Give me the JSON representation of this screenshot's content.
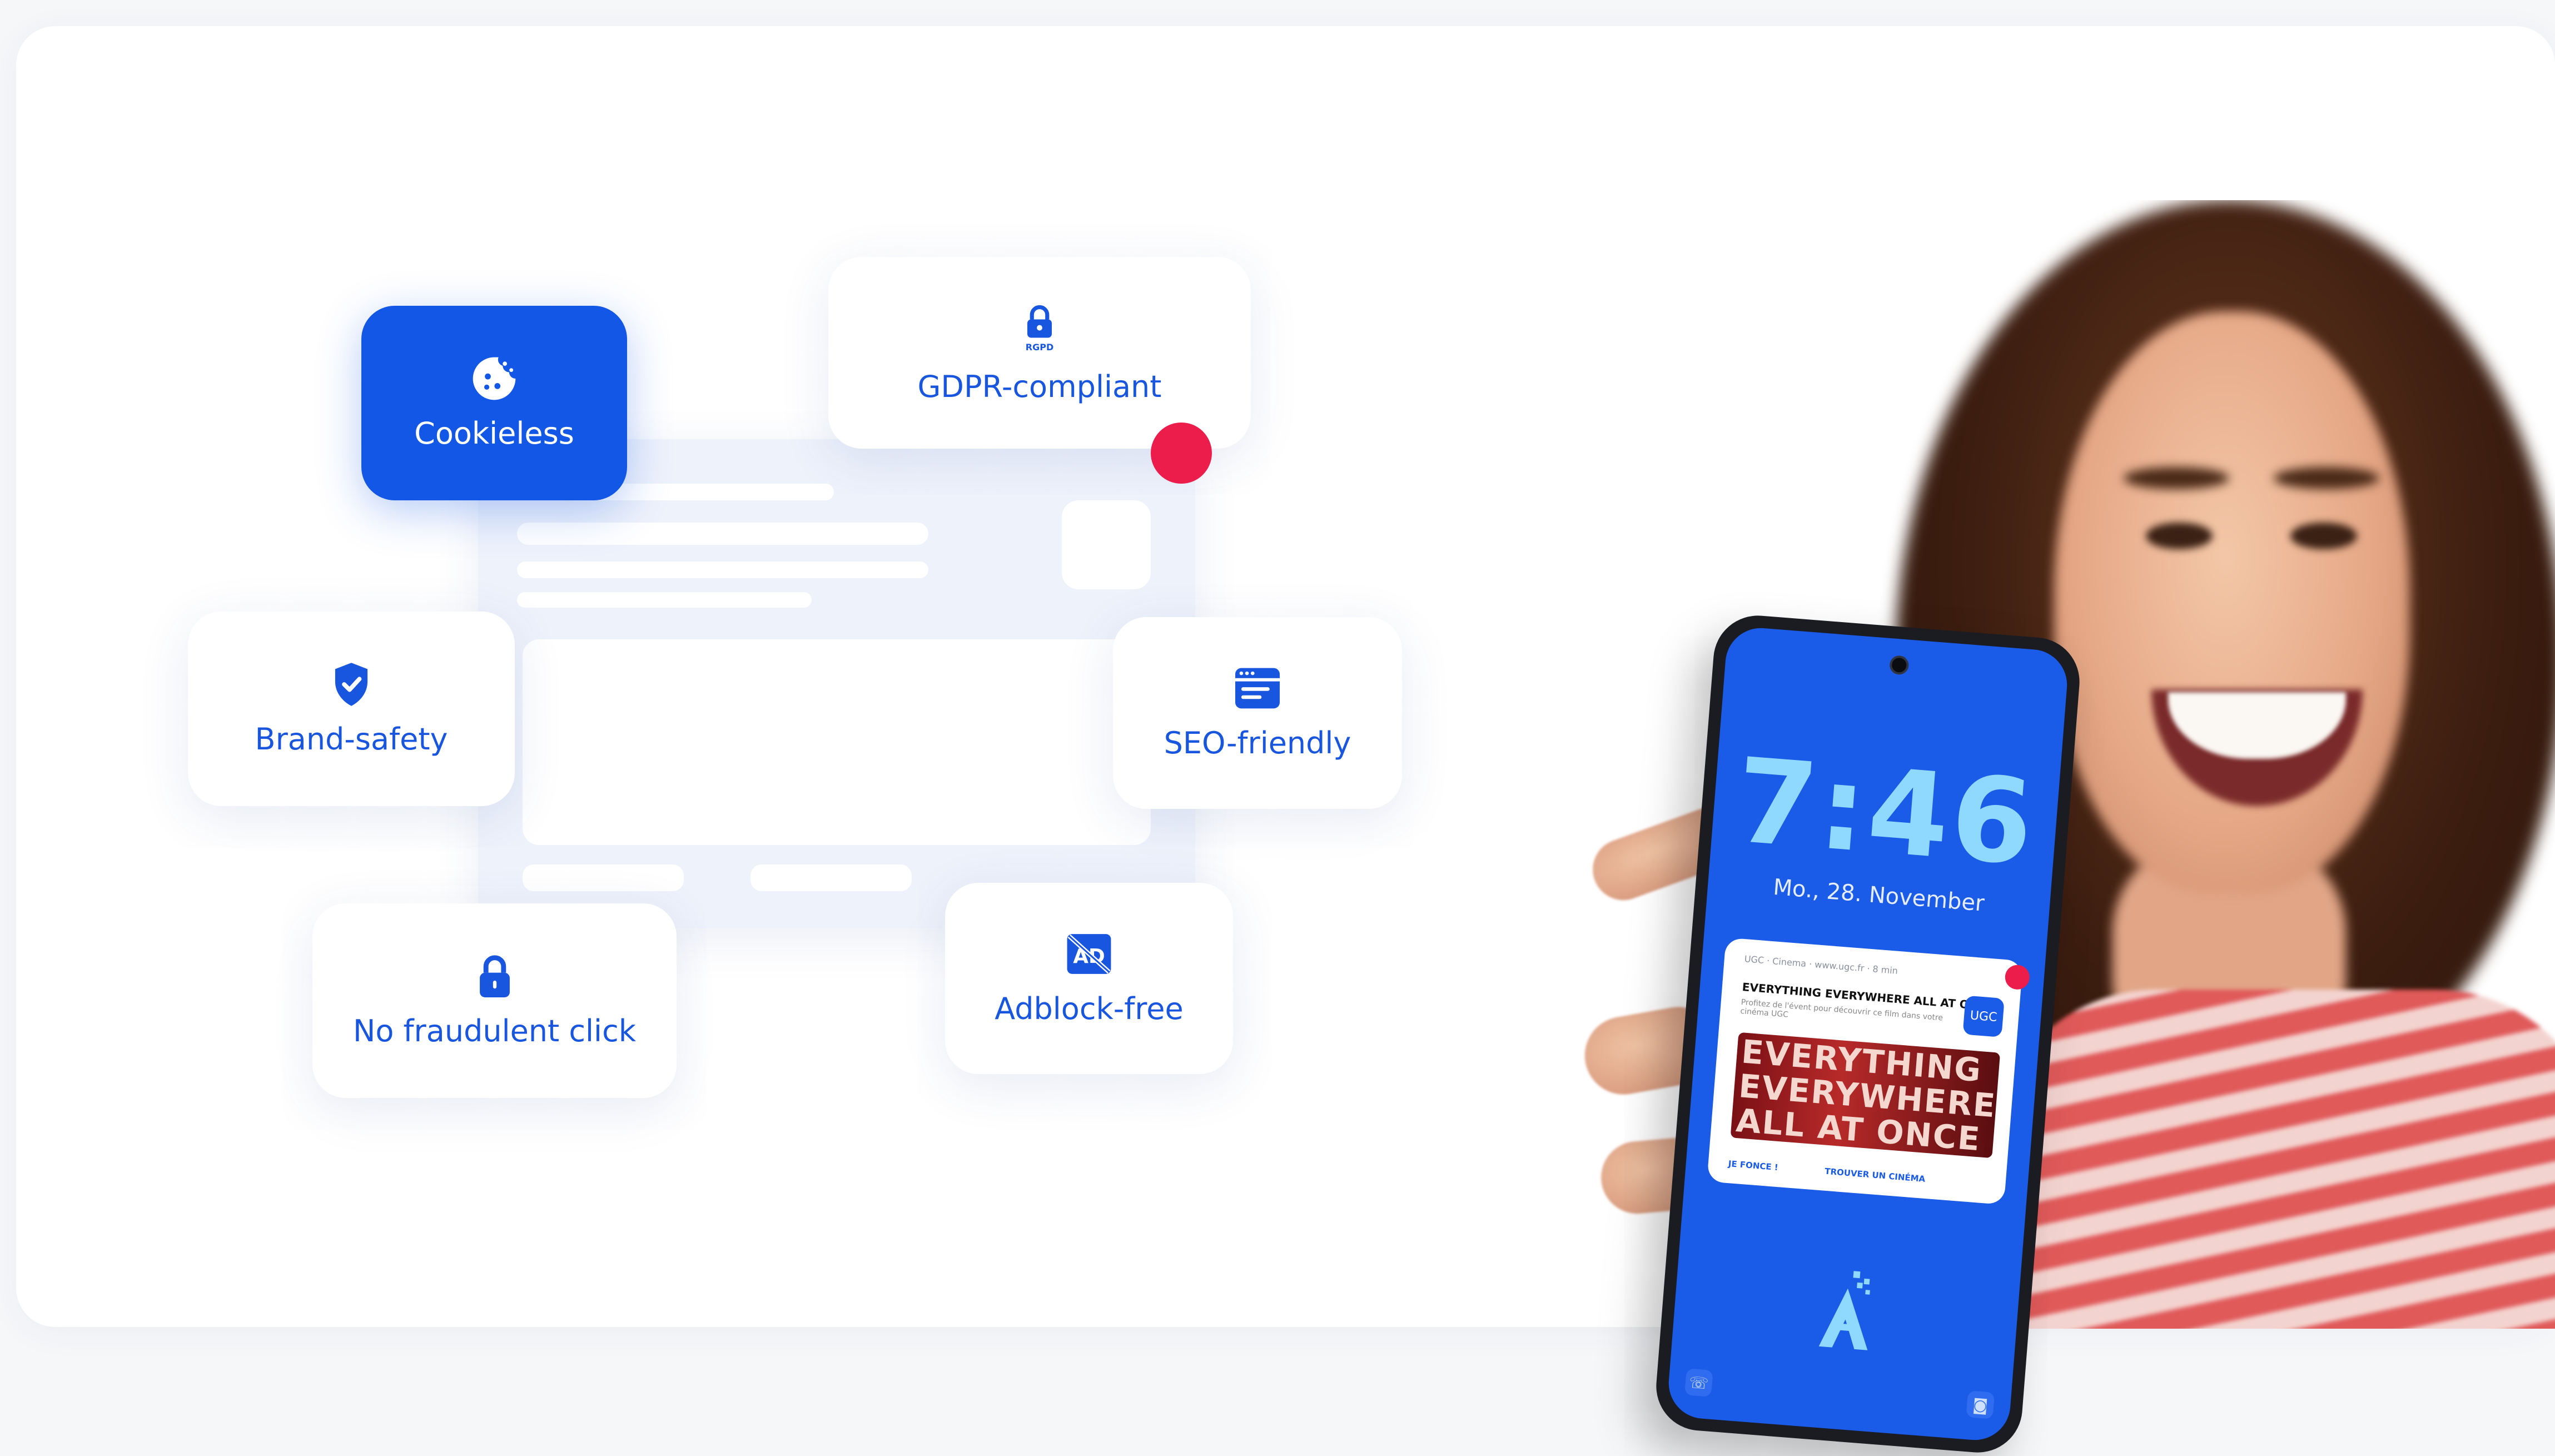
{
  "features": {
    "cookieless": "Cookieless",
    "gdpr": "GDPR-compliant",
    "gdpr_icon_caption": "RGPD",
    "brand_safety": "Brand-safety",
    "seo": "SEO-friendly",
    "fraud": "No fraudulent click",
    "adblock": "Adblock-free"
  },
  "icons": {
    "cookieless": "cookie-icon",
    "gdpr": "lock-icon",
    "brand_safety": "shield-check-icon",
    "seo": "browser-window-icon",
    "fraud": "lock-icon",
    "adblock": "ad-blocked-icon"
  },
  "phone": {
    "time": "7:46",
    "date": "Mo., 28. November",
    "notification": {
      "meta": "UGC · Cinema · www.ugc.fr · 8 min",
      "title": "EVERYTHING EVERYWHERE ALL AT ONCE",
      "description": "Profitez de l'évent pour découvrir ce film dans votre cinéma UGC",
      "badge": "UGC",
      "banner_line1": "EVERYTHING",
      "banner_line2": "EVERYWHERE",
      "banner_line3": "ALL AT ONCE",
      "action1": "JE FONCE !",
      "action2": "TROUVER UN CINÉMA"
    }
  },
  "colors": {
    "brand_blue": "#1257e6",
    "accent_red": "#ec1d4b",
    "card_text": "#1956e0"
  }
}
